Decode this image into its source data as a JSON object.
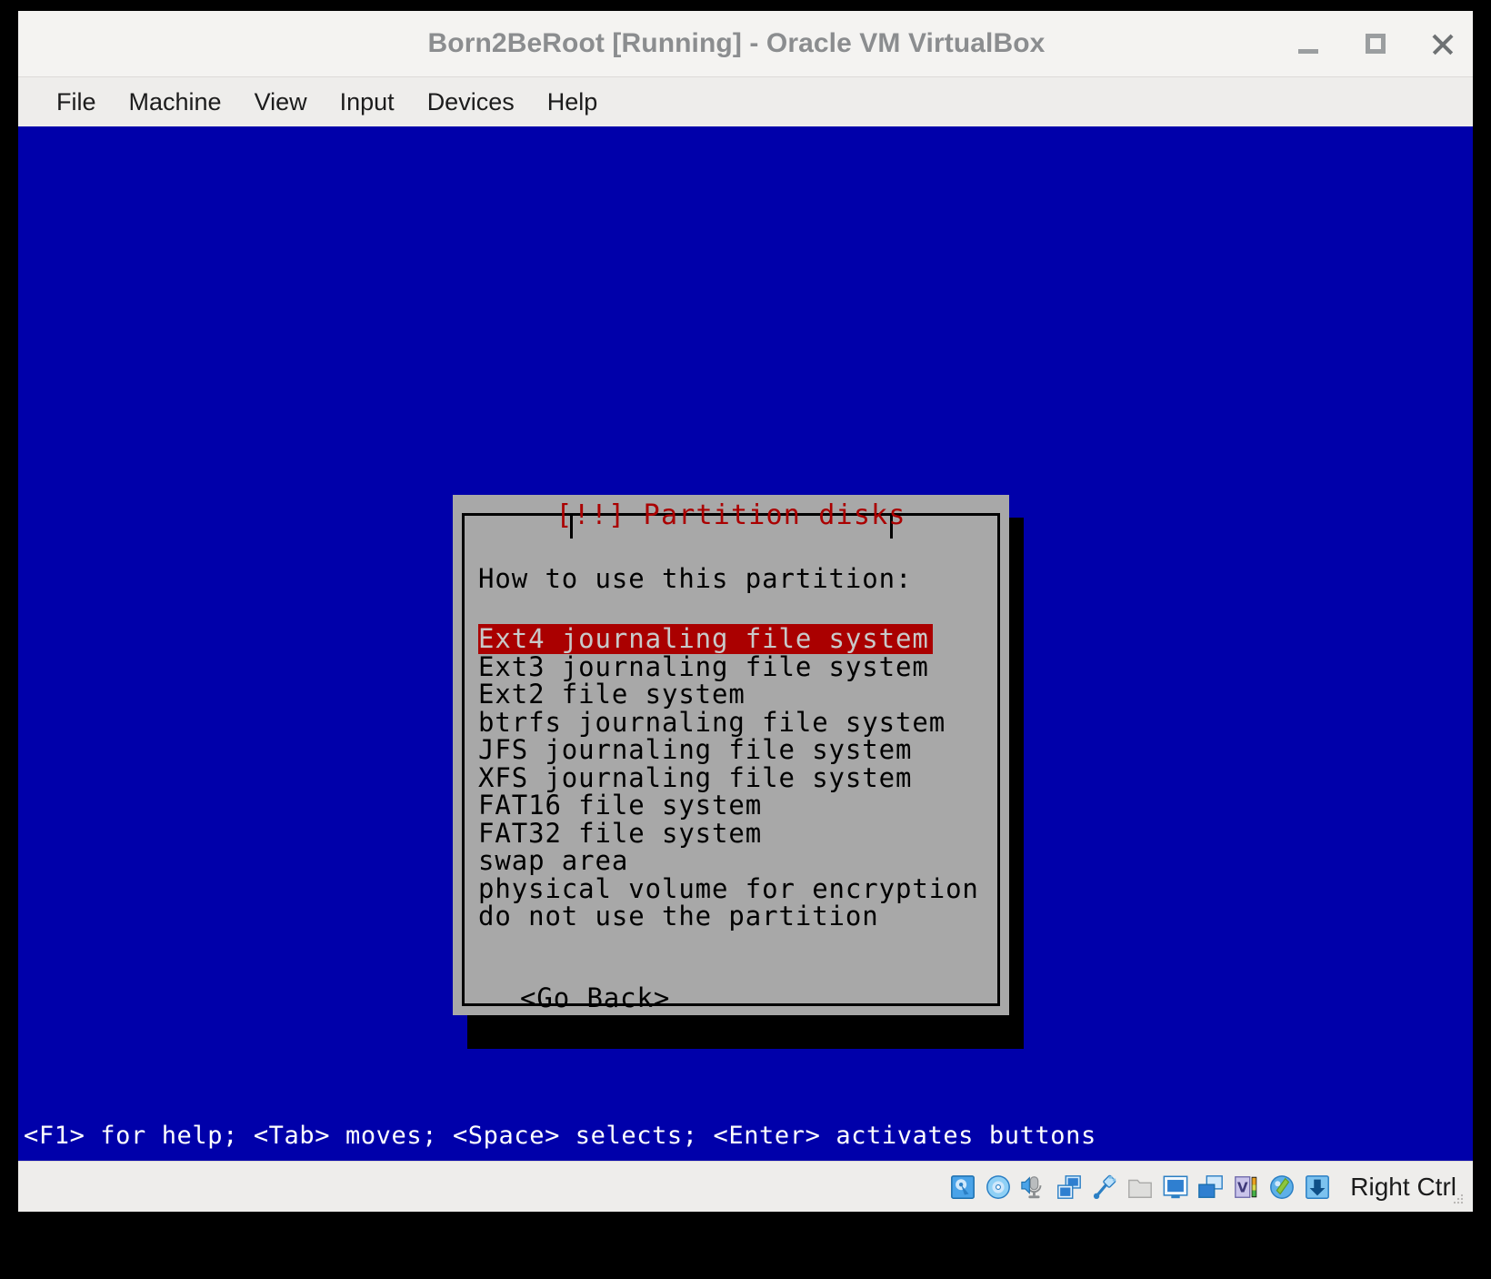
{
  "window": {
    "title": "Born2BeRoot [Running] - Oracle VM VirtualBox",
    "controls": {
      "minimize": "minimize-button",
      "maximize": "maximize-button",
      "close": "close-button"
    }
  },
  "menubar": {
    "items": [
      {
        "label": "File"
      },
      {
        "label": "Machine"
      },
      {
        "label": "View"
      },
      {
        "label": "Input"
      },
      {
        "label": "Devices"
      },
      {
        "label": "Help"
      }
    ]
  },
  "vm": {
    "background_color": "#0000aa",
    "dialog": {
      "title": "[!!] Partition disks",
      "title_color": "#aa0000",
      "background_color": "#a8a8a8",
      "prompt": "How to use this partition:",
      "options": [
        {
          "label": "Ext4 journaling file system",
          "selected": true
        },
        {
          "label": "Ext3 journaling file system",
          "selected": false
        },
        {
          "label": "Ext2 file system",
          "selected": false
        },
        {
          "label": "btrfs journaling file system",
          "selected": false
        },
        {
          "label": "JFS journaling file system",
          "selected": false
        },
        {
          "label": "XFS journaling file system",
          "selected": false
        },
        {
          "label": "FAT16 file system",
          "selected": false
        },
        {
          "label": "FAT32 file system",
          "selected": false
        },
        {
          "label": "swap area",
          "selected": false
        },
        {
          "label": "physical volume for encryption",
          "selected": false
        },
        {
          "label": "do not use the partition",
          "selected": false
        }
      ],
      "selection_bg_color": "#aa0000",
      "selection_fg_color": "#c9c9c9",
      "buttons": [
        {
          "label": "<Go Back>"
        }
      ]
    },
    "help_line": "<F1> for help; <Tab> moves; <Space> selects; <Enter> activates buttons"
  },
  "statusbar": {
    "icons": [
      {
        "name": "hard-disk-icon"
      },
      {
        "name": "optical-disk-icon"
      },
      {
        "name": "audio-icon"
      },
      {
        "name": "network-icon"
      },
      {
        "name": "usb-icon"
      },
      {
        "name": "shared-folders-icon"
      },
      {
        "name": "display-icon"
      },
      {
        "name": "recording-icon"
      },
      {
        "name": "features-icon"
      },
      {
        "name": "mouse-integration-icon"
      },
      {
        "name": "keyboard-capture-icon"
      }
    ],
    "host_key": "Right Ctrl"
  }
}
